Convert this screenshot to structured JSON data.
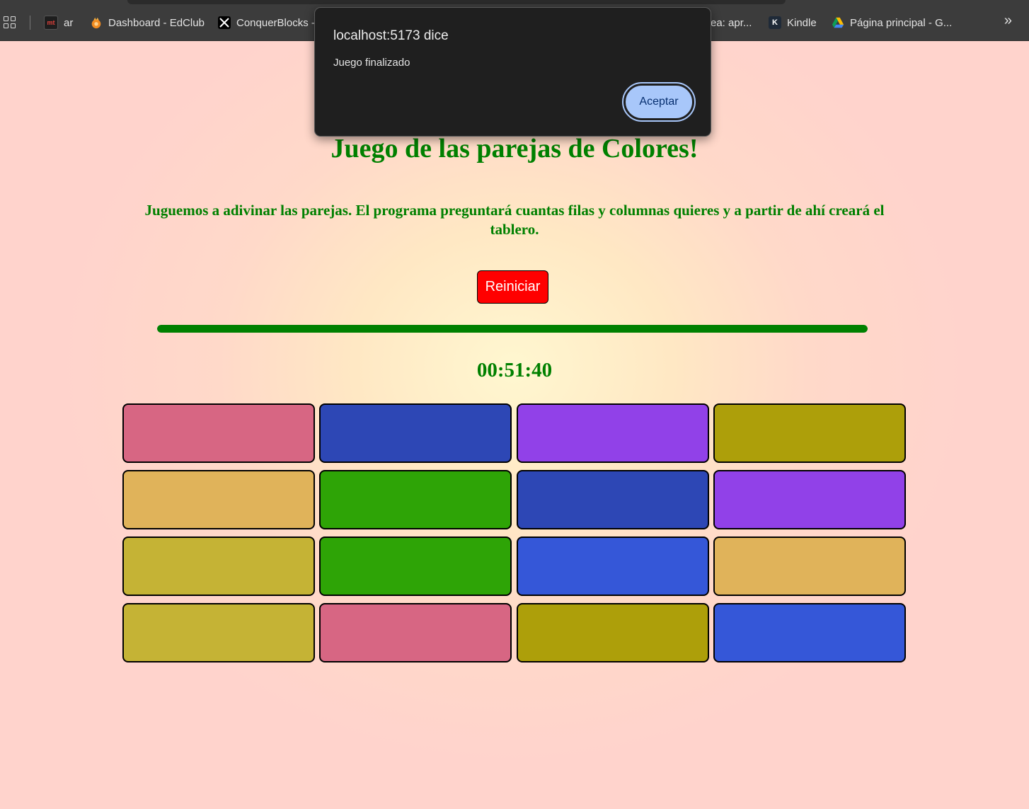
{
  "bookmarks": [
    {
      "label": "ar",
      "icon": "mt-icon"
    },
    {
      "label": "Dashboard - EdClub",
      "icon": "edclub-icon"
    },
    {
      "label": "ConquerBlocks -",
      "icon": "x-icon"
    },
    {
      "label": "ea: apr...",
      "icon": ""
    },
    {
      "label": "Kindle",
      "icon": "kindle-icon"
    },
    {
      "label": "Página principal - G...",
      "icon": "drive-icon"
    }
  ],
  "dialog": {
    "title": "localhost:5173 dice",
    "message": "Juego finalizado",
    "accept_label": "Aceptar"
  },
  "game": {
    "title": "Juego de las parejas de Colores!",
    "description": "Juguemos a adivinar las parejas. El programa preguntará cuantas filas y columnas quieres y a partir de ahí creará el tablero.",
    "restart_label": "Reiniciar",
    "progress_fraction": 1.0,
    "timer": "00:51:40",
    "board": {
      "rows": 4,
      "columns": 4,
      "cards": [
        "#d76683",
        "#2d47b5",
        "#9141e8",
        "#ad9f0a",
        "#e0b35a",
        "#2ea406",
        "#2d47b5",
        "#9141e8",
        "#c5b335",
        "#2ea406",
        "#3557d8",
        "#e0b35a",
        "#c5b335",
        "#d76683",
        "#ad9f0a",
        "#3557d8"
      ]
    }
  }
}
